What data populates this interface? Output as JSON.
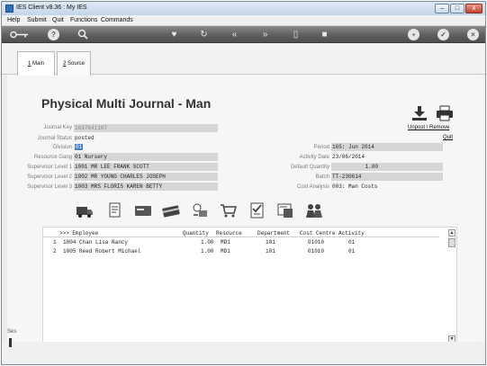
{
  "window": {
    "title": "IES Client v8.36 : My IES",
    "controls": {
      "minimize": "–",
      "maximize": "□",
      "close": "x"
    }
  },
  "menubar": {
    "items": [
      "Help",
      "Submit",
      "Quit",
      "Functions",
      "Commands"
    ]
  },
  "toolbar": {
    "icons": [
      "key-icon",
      "help-icon",
      "search-icon",
      "heart-icon",
      "refresh-icon",
      "first-icon",
      "last-icon",
      "bin-icon",
      "stop-icon",
      "lock-icon",
      "check-icon",
      "close-icon"
    ]
  },
  "tabs": [
    {
      "label": "1 Main",
      "hotkey": "1",
      "rest": " Main"
    },
    {
      "label": "2 Source",
      "hotkey": "2",
      "rest": " Source"
    }
  ],
  "form": {
    "title": "Physical Multi Journal - Man",
    "left_fields": [
      {
        "label": "Journal Key",
        "value": "1697641107"
      },
      {
        "label": "Journal Status",
        "value": "posted"
      },
      {
        "label": "Division",
        "value": "01"
      },
      {
        "label": "Resource Gang",
        "value": "01 Nursery"
      },
      {
        "label": "Supervisor Level 1",
        "value": "1001 MR LEE FRANK SCOTT"
      },
      {
        "label": "Supervisor Level 2",
        "value": "1002 MR YOUNG CHARLES JOSEPH"
      },
      {
        "label": "Supervisor Level 3",
        "value": "1003 MRS FLORIS KAREN BETTY"
      }
    ],
    "right_fields": [
      {
        "label": "Period",
        "value": "165: Jun 2014"
      },
      {
        "label": "Activity Date",
        "value": "23/06/2014"
      },
      {
        "label": "Default Quantity",
        "value": "1.00"
      },
      {
        "label": "Batch",
        "value": "TT-230614"
      },
      {
        "label": "Cost Analysis",
        "value": "003: Man Costs"
      }
    ],
    "actions": {
      "unpost_label": "Unpost / Remove",
      "quit_label": "Quit"
    }
  },
  "action_icons": [
    "truck-icon",
    "document-icon",
    "card-icon",
    "payment-card-icon",
    "swap-icon",
    "cart-icon",
    "checklist-icon",
    "stamp-icon",
    "people-icon"
  ],
  "grid": {
    "columns": [
      ">>> Employee",
      "Quantity",
      "Resource",
      "Department",
      "Cost Centre",
      "Activity"
    ],
    "rows": [
      {
        "num": "1",
        "employee": "1004 Chan Lisa Nancy",
        "quantity": "1.00",
        "resource": "MD1",
        "department": "101",
        "cost_centre": "01010",
        "activity": "01"
      },
      {
        "num": "2",
        "employee": "1005 Reed Robert Michael",
        "quantity": "1.00",
        "resource": "MD1",
        "department": "101",
        "cost_centre": "01010",
        "activity": "01"
      }
    ]
  },
  "status": {
    "side_text": "Ses"
  }
}
